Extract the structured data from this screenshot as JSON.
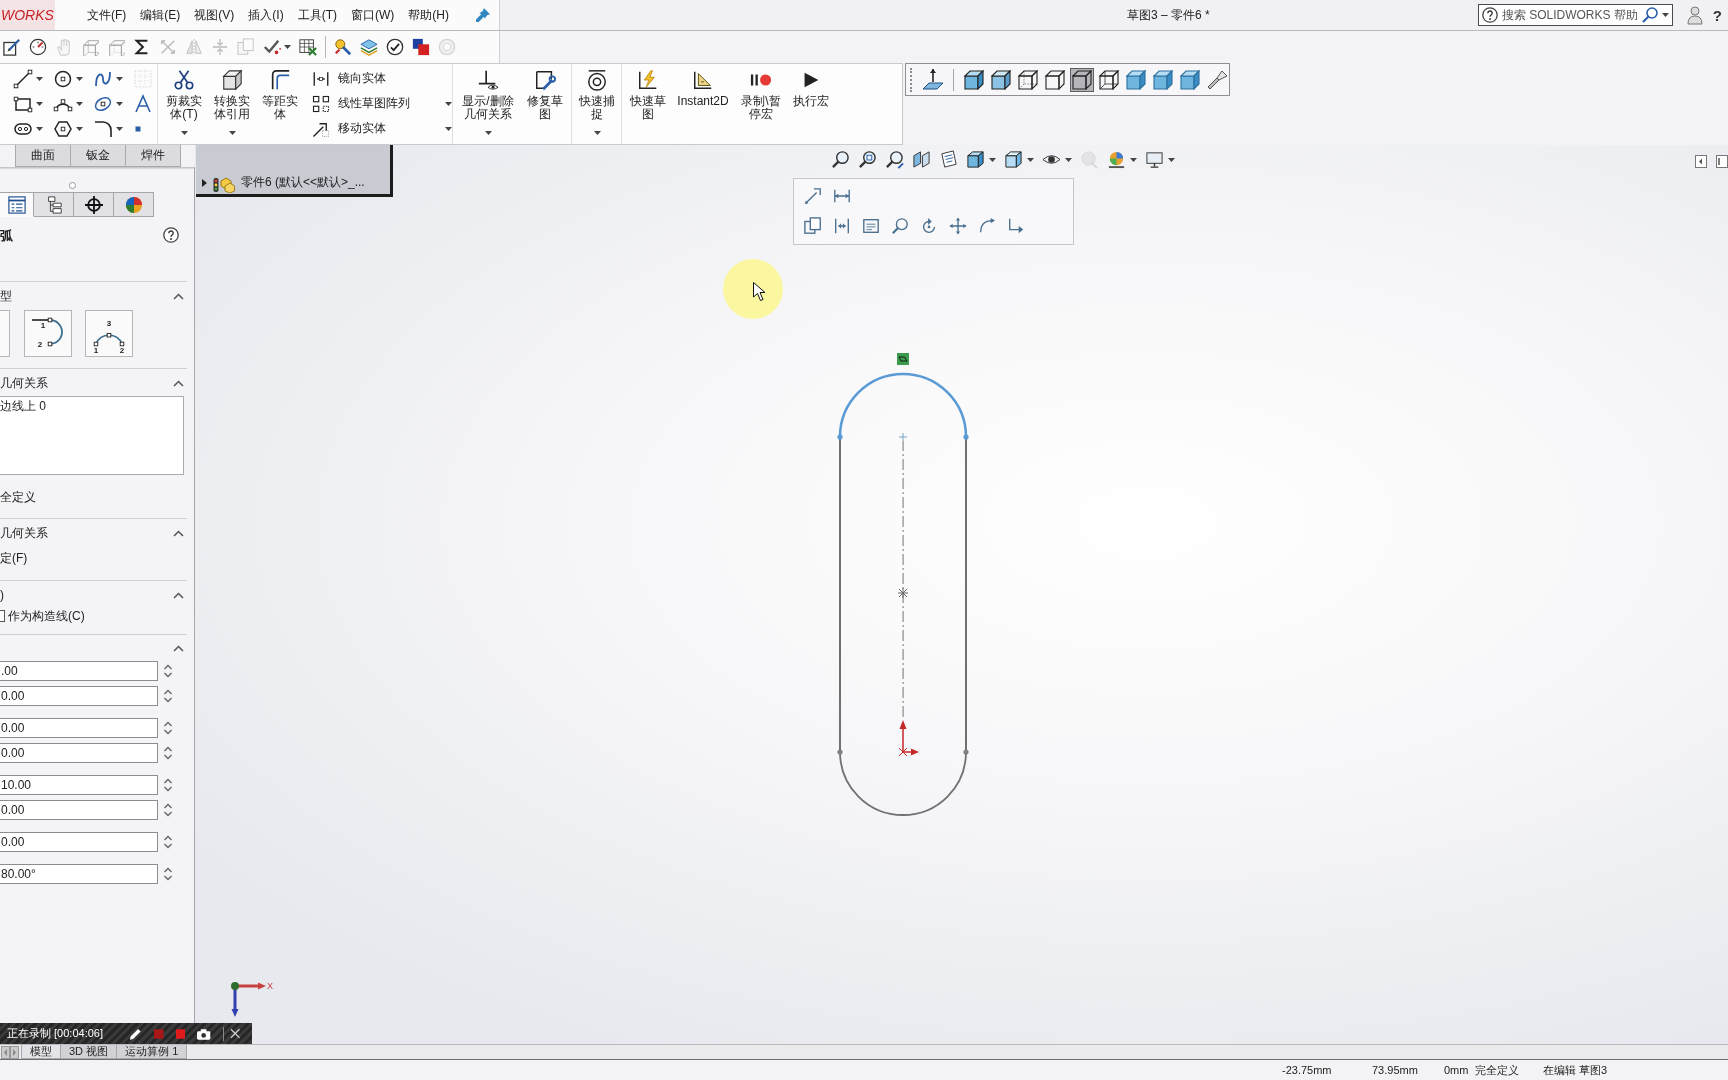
{
  "title_bar": {
    "logo": "WORKS",
    "menu": [
      "文件(F)",
      "编辑(E)",
      "视图(V)",
      "插入(I)",
      "工具(T)",
      "窗口(W)",
      "帮助(H)"
    ],
    "title": "草图3 – 零件6 *",
    "search": {
      "placeholder": "搜索 SOLIDWORKS 帮助"
    },
    "help": "?"
  },
  "toolbar": {
    "buttons": [
      {
        "disabled": false,
        "dropdown": false
      },
      {
        "disabled": false,
        "dropdown": false
      },
      {
        "disabled": true,
        "dropdown": false
      },
      {
        "disabled": true,
        "dropdown": false
      },
      {
        "disabled": true,
        "dropdown": false
      },
      {
        "disabled": false,
        "dropdown": false
      },
      {
        "disabled": true,
        "dropdown": false
      },
      {
        "disabled": true,
        "dropdown": false
      },
      {
        "disabled": true,
        "dropdown": false
      },
      {
        "disabled": true,
        "dropdown": false
      },
      {
        "disabled": false,
        "dropdown": true
      },
      {
        "disabled": false,
        "dropdown": false
      },
      {
        "disabled": false,
        "dropdown": false
      },
      {
        "disabled": false,
        "dropdown": false
      },
      {
        "disabled": false,
        "dropdown": false
      },
      {
        "disabled": false,
        "dropdown": false
      },
      {
        "disabled": true,
        "dropdown": false
      }
    ]
  },
  "ribbon": {
    "groups": [
      {
        "kind": "tool_grid",
        "tools": [
          {
            "disabled": false,
            "dropdown": true
          },
          {
            "disabled": false,
            "dropdown": true
          },
          {
            "disabled": false,
            "dropdown": true
          },
          {
            "disabled": false,
            "dropdown": true
          },
          {
            "disabled": false,
            "dropdown": true
          },
          {
            "disabled": false,
            "dropdown": true
          },
          {
            "disabled": false,
            "dropdown": true
          },
          {
            "disabled": false,
            "dropdown": true
          },
          {
            "disabled": false,
            "dropdown": true
          },
          {
            "disabled": true,
            "dropdown": false
          },
          {
            "disabled": false,
            "dropdown": false
          },
          {
            "disabled": false,
            "dropdown": false
          }
        ]
      },
      {
        "kind": "commands",
        "items": [
          {
            "kind": "large",
            "label": "剪裁实体(T)",
            "dropdown": true
          },
          {
            "kind": "large",
            "label": "转换实体引用",
            "dropdown": true
          },
          {
            "kind": "large",
            "label": "等距实体",
            "dropdown": false
          },
          {
            "kind": "small",
            "label": "镜向实体",
            "dropdown": false
          },
          {
            "kind": "small",
            "label": "线性草图阵列",
            "dropdown": true
          },
          {
            "kind": "small",
            "label": "移动实体",
            "dropdown": true
          }
        ]
      },
      {
        "kind": "commands",
        "items": [
          {
            "kind": "large",
            "label": "显示/删除几何关系",
            "dropdown": true
          },
          {
            "kind": "large",
            "label": "修复草图",
            "dropdown": false
          }
        ]
      },
      {
        "kind": "commands",
        "items": [
          {
            "kind": "large",
            "label": "快速捕捉",
            "dropdown": true
          }
        ]
      },
      {
        "kind": "commands",
        "items": [
          {
            "kind": "large",
            "label": "快速草图",
            "dropdown": false
          },
          {
            "kind": "large",
            "label": "Instant2D",
            "dropdown": false
          },
          {
            "kind": "large",
            "label": "录制\\暂停宏",
            "dropdown": false
          },
          {
            "kind": "large",
            "label": "执行宏",
            "dropdown": false
          }
        ]
      }
    ]
  },
  "view_toolbar": {
    "buttons": [
      {
        "selected": false
      },
      {
        "selected": false
      },
      {
        "selected": false
      },
      {
        "selected": false
      },
      {
        "selected": false
      },
      {
        "selected": true
      },
      {
        "selected": false
      },
      {
        "selected": false
      },
      {
        "selected": false
      },
      {
        "selected": false
      },
      {
        "selected": false
      }
    ]
  },
  "command_tabs": [
    {
      "label": "曲面",
      "selected": false
    },
    {
      "label": "钣金",
      "selected": false
    },
    {
      "label": "焊件",
      "selected": false
    }
  ],
  "property_manager": {
    "tabs": [
      {
        "selected": true
      },
      {
        "selected": false
      },
      {
        "selected": false
      },
      {
        "selected": false
      }
    ],
    "title": "弧",
    "sections": [
      {
        "kind": "type",
        "title": "型",
        "expanded": true,
        "options": [
          {
            "selected": false
          },
          {
            "selected": false,
            "labels": [
              "1",
              "2"
            ]
          },
          {
            "selected": false,
            "labels": [
              "3",
              "1",
              "2"
            ]
          }
        ]
      },
      {
        "kind": "relations",
        "title": "几何关系",
        "expanded": true,
        "items": [
          "边线上 0"
        ],
        "status": "全定义"
      },
      {
        "kind": "add_relations",
        "title": "几何关系",
        "expanded": true,
        "items": [
          "定(F)"
        ]
      },
      {
        "kind": "options",
        "title": ")",
        "expanded": true,
        "checkboxes": [
          {
            "label": "作为构造线(C)",
            "checked": false
          }
        ]
      },
      {
        "kind": "parameters",
        "expanded": true,
        "field_groups": [
          [
            ".00",
            "0.00"
          ],
          [
            "0.00",
            "0.00"
          ],
          [
            "10.00",
            "0.00"
          ],
          [
            "0.00"
          ],
          [
            "80.00°"
          ]
        ]
      }
    ]
  },
  "feature_tree": {
    "items": [
      {
        "label": "零件6 (默认<<默认>_...",
        "expanded": false
      }
    ]
  },
  "heads_up_toolbar": {
    "buttons": [
      {
        "disabled": false,
        "dropdown": false
      },
      {
        "disabled": false,
        "dropdown": false
      },
      {
        "disabled": false,
        "dropdown": false
      },
      {
        "disabled": false,
        "dropdown": false
      },
      {
        "disabled": false,
        "dropdown": false
      },
      {
        "disabled": false,
        "dropdown": true
      },
      {
        "disabled": false,
        "dropdown": true
      },
      {
        "disabled": false,
        "dropdown": true
      },
      {
        "disabled": true,
        "dropdown": false
      },
      {
        "disabled": false,
        "dropdown": true
      },
      {
        "disabled": false,
        "dropdown": true
      }
    ]
  },
  "context_toolbar": {
    "rows": [
      {
        "buttons": [
          {
            "disabled": false
          },
          {
            "disabled": false
          }
        ]
      },
      {
        "buttons": [
          {
            "disabled": false
          },
          {
            "disabled": false
          },
          {
            "disabled": false
          },
          {
            "disabled": false
          },
          {
            "disabled": false
          },
          {
            "disabled": false
          },
          {
            "disabled": false
          },
          {
            "disabled": false
          }
        ]
      }
    ]
  },
  "sketch": {
    "entities": [
      {
        "kind": "arc",
        "selected": true
      },
      {
        "kind": "line",
        "selected": false
      },
      {
        "kind": "arc",
        "selected": false
      },
      {
        "kind": "line",
        "selected": false
      },
      {
        "kind": "centerline",
        "selected": false
      }
    ]
  },
  "triad": {
    "x_label": "X"
  },
  "recording": {
    "label": "正在录制 [00:04:06]"
  },
  "bottom_tabs": [
    {
      "label": "模型",
      "selected": true
    },
    {
      "label": "3D 视图",
      "selected": false
    },
    {
      "label": "运动算例 1",
      "selected": false
    }
  ],
  "status_bar": {
    "readouts": [
      "-23.75mm",
      "73.95mm",
      "0mm"
    ],
    "status": "完全定义",
    "mode": "在编辑 草图3"
  }
}
